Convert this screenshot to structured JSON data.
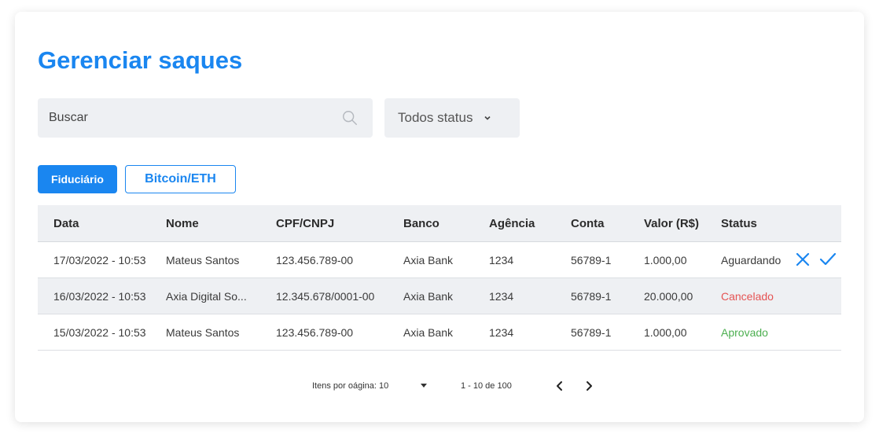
{
  "page": {
    "title": "Gerenciar saques"
  },
  "filters": {
    "search_placeholder": "Buscar",
    "status_selected": "Todos status"
  },
  "tabs": [
    {
      "label": "Fiduciário",
      "active": true
    },
    {
      "label": "Bitcoin/ETH",
      "active": false
    }
  ],
  "table": {
    "columns": [
      "Data",
      "Nome",
      "CPF/CNPJ",
      "Banco",
      "Agência",
      "Conta",
      "Valor (R$)",
      "Status"
    ],
    "rows": [
      [
        "17/03/2022 - 10:53",
        "Mateus Santos",
        "123.456.789-00",
        "Axia Bank",
        "1234",
        "56789-1",
        "1.000,00",
        "Aguardando"
      ],
      [
        "16/03/2022 - 10:53",
        "Axia Digital So...",
        "12.345.678/0001-00",
        "Axia Bank",
        "1234",
        "56789-1",
        "20.000,00",
        "Cancelado"
      ],
      [
        "15/03/2022 - 10:53",
        "Mateus Santos",
        "123.456.789-00",
        "Axia Bank",
        "1234",
        "56789-1",
        "1.000,00",
        "Aprovado"
      ]
    ]
  },
  "pagination": {
    "items_per_page_label": "Itens por oágina: 10",
    "range": "1 - 10 de 100"
  },
  "colors": {
    "accent": "#1a86f0",
    "cancelled": "#e55353",
    "approved": "#4caf50",
    "surface": "#eef0f3"
  },
  "icons": [
    "search-icon",
    "chevron-down-icon",
    "close-icon",
    "check-icon",
    "chevron-left-icon",
    "chevron-right-icon"
  ]
}
